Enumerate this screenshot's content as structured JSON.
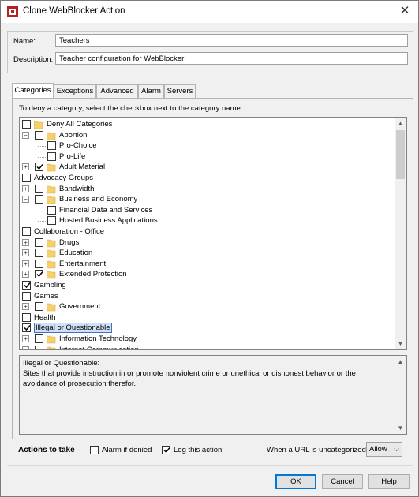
{
  "window": {
    "title": "Clone WebBlocker Action",
    "close_glyph": "✕"
  },
  "form": {
    "name_label": "Name:",
    "name_value": "Teachers",
    "description_label": "Description:",
    "description_value": "Teacher configuration for WebBlocker"
  },
  "tabs": [
    {
      "label": "Categories",
      "active": true
    },
    {
      "label": "Exceptions",
      "active": false
    },
    {
      "label": "Advanced",
      "active": false
    },
    {
      "label": "Alarm",
      "active": false
    },
    {
      "label": "Servers",
      "active": false
    }
  ],
  "categories_panel": {
    "instruction": "To deny a category, select the checkbox next to the category name.",
    "tree": [
      {
        "label": "Deny All Categories",
        "level": 0,
        "expander": "",
        "checked": false,
        "folder": true
      },
      {
        "label": "Abortion",
        "level": 0,
        "expander": "-",
        "checked": false,
        "folder": true
      },
      {
        "label": "Pro-Choice",
        "level": 1,
        "expander": "",
        "checked": false,
        "folder": false
      },
      {
        "label": "Pro-Life",
        "level": 1,
        "expander": "",
        "checked": false,
        "folder": false
      },
      {
        "label": "Adult Material",
        "level": 0,
        "expander": "+",
        "checked": true,
        "folder": true
      },
      {
        "label": "Advocacy Groups",
        "level": 0,
        "expander": "",
        "checked": false,
        "folder": false
      },
      {
        "label": "Bandwidth",
        "level": 0,
        "expander": "+",
        "checked": false,
        "folder": true
      },
      {
        "label": "Business and Economy",
        "level": 0,
        "expander": "-",
        "checked": false,
        "folder": true
      },
      {
        "label": "Financial Data and Services",
        "level": 1,
        "expander": "",
        "checked": false,
        "folder": false
      },
      {
        "label": "Hosted Business Applications",
        "level": 1,
        "expander": "",
        "checked": false,
        "folder": false
      },
      {
        "label": "Collaboration - Office",
        "level": 0,
        "expander": "",
        "checked": false,
        "folder": false
      },
      {
        "label": "Drugs",
        "level": 0,
        "expander": "+",
        "checked": false,
        "folder": true
      },
      {
        "label": "Education",
        "level": 0,
        "expander": "+",
        "checked": false,
        "folder": true
      },
      {
        "label": "Entertainment",
        "level": 0,
        "expander": "+",
        "checked": false,
        "folder": true
      },
      {
        "label": "Extended Protection",
        "level": 0,
        "expander": "+",
        "checked": true,
        "folder": true
      },
      {
        "label": "Gambling",
        "level": 0,
        "expander": "",
        "checked": true,
        "folder": false
      },
      {
        "label": "Games",
        "level": 0,
        "expander": "",
        "checked": false,
        "folder": false
      },
      {
        "label": "Government",
        "level": 0,
        "expander": "+",
        "checked": false,
        "folder": true
      },
      {
        "label": "Health",
        "level": 0,
        "expander": "",
        "checked": false,
        "folder": false
      },
      {
        "label": "Illegal or Questionable",
        "level": 0,
        "expander": "",
        "checked": true,
        "folder": false,
        "selected": true
      },
      {
        "label": "Information Technology",
        "level": 0,
        "expander": "+",
        "checked": false,
        "folder": true
      },
      {
        "label": "Internet Communication",
        "level": 0,
        "expander": "-",
        "checked": false,
        "folder": true
      }
    ],
    "description": {
      "title": "Illegal or Questionable:",
      "text": "Sites that provide instruction in or promote nonviolent crime or unethical or dishonest behavior or the avoidance of prosecution therefor."
    }
  },
  "actions": {
    "label": "Actions to take",
    "alarm_label": "Alarm if denied",
    "alarm_checked": false,
    "log_label": "Log this action",
    "log_checked": true,
    "uncategorized_label": "When a URL is uncategorized",
    "uncategorized_value": "Allow"
  },
  "buttons": {
    "ok": "OK",
    "cancel": "Cancel",
    "help": "Help"
  },
  "colors": {
    "folder": "#f6d06b",
    "selection": "#cfe0f7",
    "default_button_border": "#0078d7"
  }
}
